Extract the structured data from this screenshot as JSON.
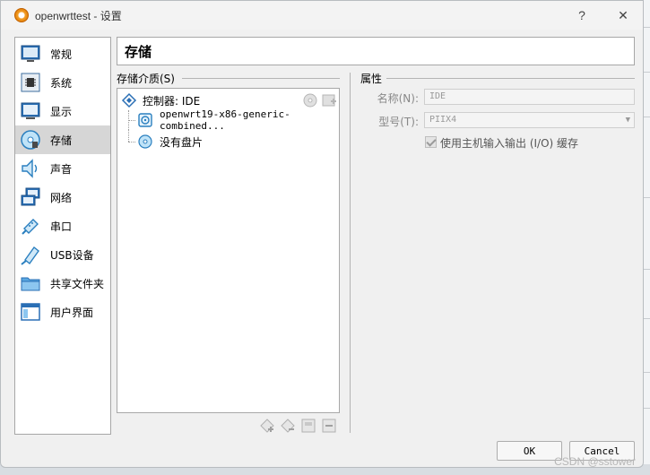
{
  "window": {
    "title": "openwrttest - 设置",
    "help_glyph": "?",
    "close_glyph": "✕"
  },
  "sidebar": {
    "items": [
      {
        "label": "常规",
        "icon": "general-icon"
      },
      {
        "label": "系统",
        "icon": "system-icon"
      },
      {
        "label": "显示",
        "icon": "display-icon"
      },
      {
        "label": "存储",
        "icon": "storage-icon",
        "selected": true
      },
      {
        "label": "声音",
        "icon": "audio-icon"
      },
      {
        "label": "网络",
        "icon": "network-icon"
      },
      {
        "label": "串口",
        "icon": "serial-port-icon"
      },
      {
        "label": "USB设备",
        "icon": "usb-icon"
      },
      {
        "label": "共享文件夹",
        "icon": "shared-folder-icon"
      },
      {
        "label": "用户界面",
        "icon": "user-interface-icon"
      }
    ]
  },
  "page_title": "存储",
  "storage": {
    "group_title": "存储介质(S)",
    "controller_label": "控制器: IDE",
    "attachments": [
      {
        "label": "openwrt19-x86-generic-combined...",
        "icon": "hard-disk-icon"
      },
      {
        "label": "没有盘片",
        "icon": "optical-disc-icon"
      }
    ]
  },
  "attributes": {
    "group_title": "属性",
    "name_label": "名称(N):",
    "name_value": "IDE",
    "type_label": "型号(T):",
    "type_value": "PIIX4",
    "host_cache_label": "使用主机输入输出 (I/O) 缓存",
    "host_cache_checked": true
  },
  "buttons": {
    "ok": "OK",
    "cancel": "Cancel"
  },
  "watermark": "CSDN @sstower",
  "colors": {
    "accent": "#1c72c6",
    "selected_bg": "#d6d6d6"
  }
}
